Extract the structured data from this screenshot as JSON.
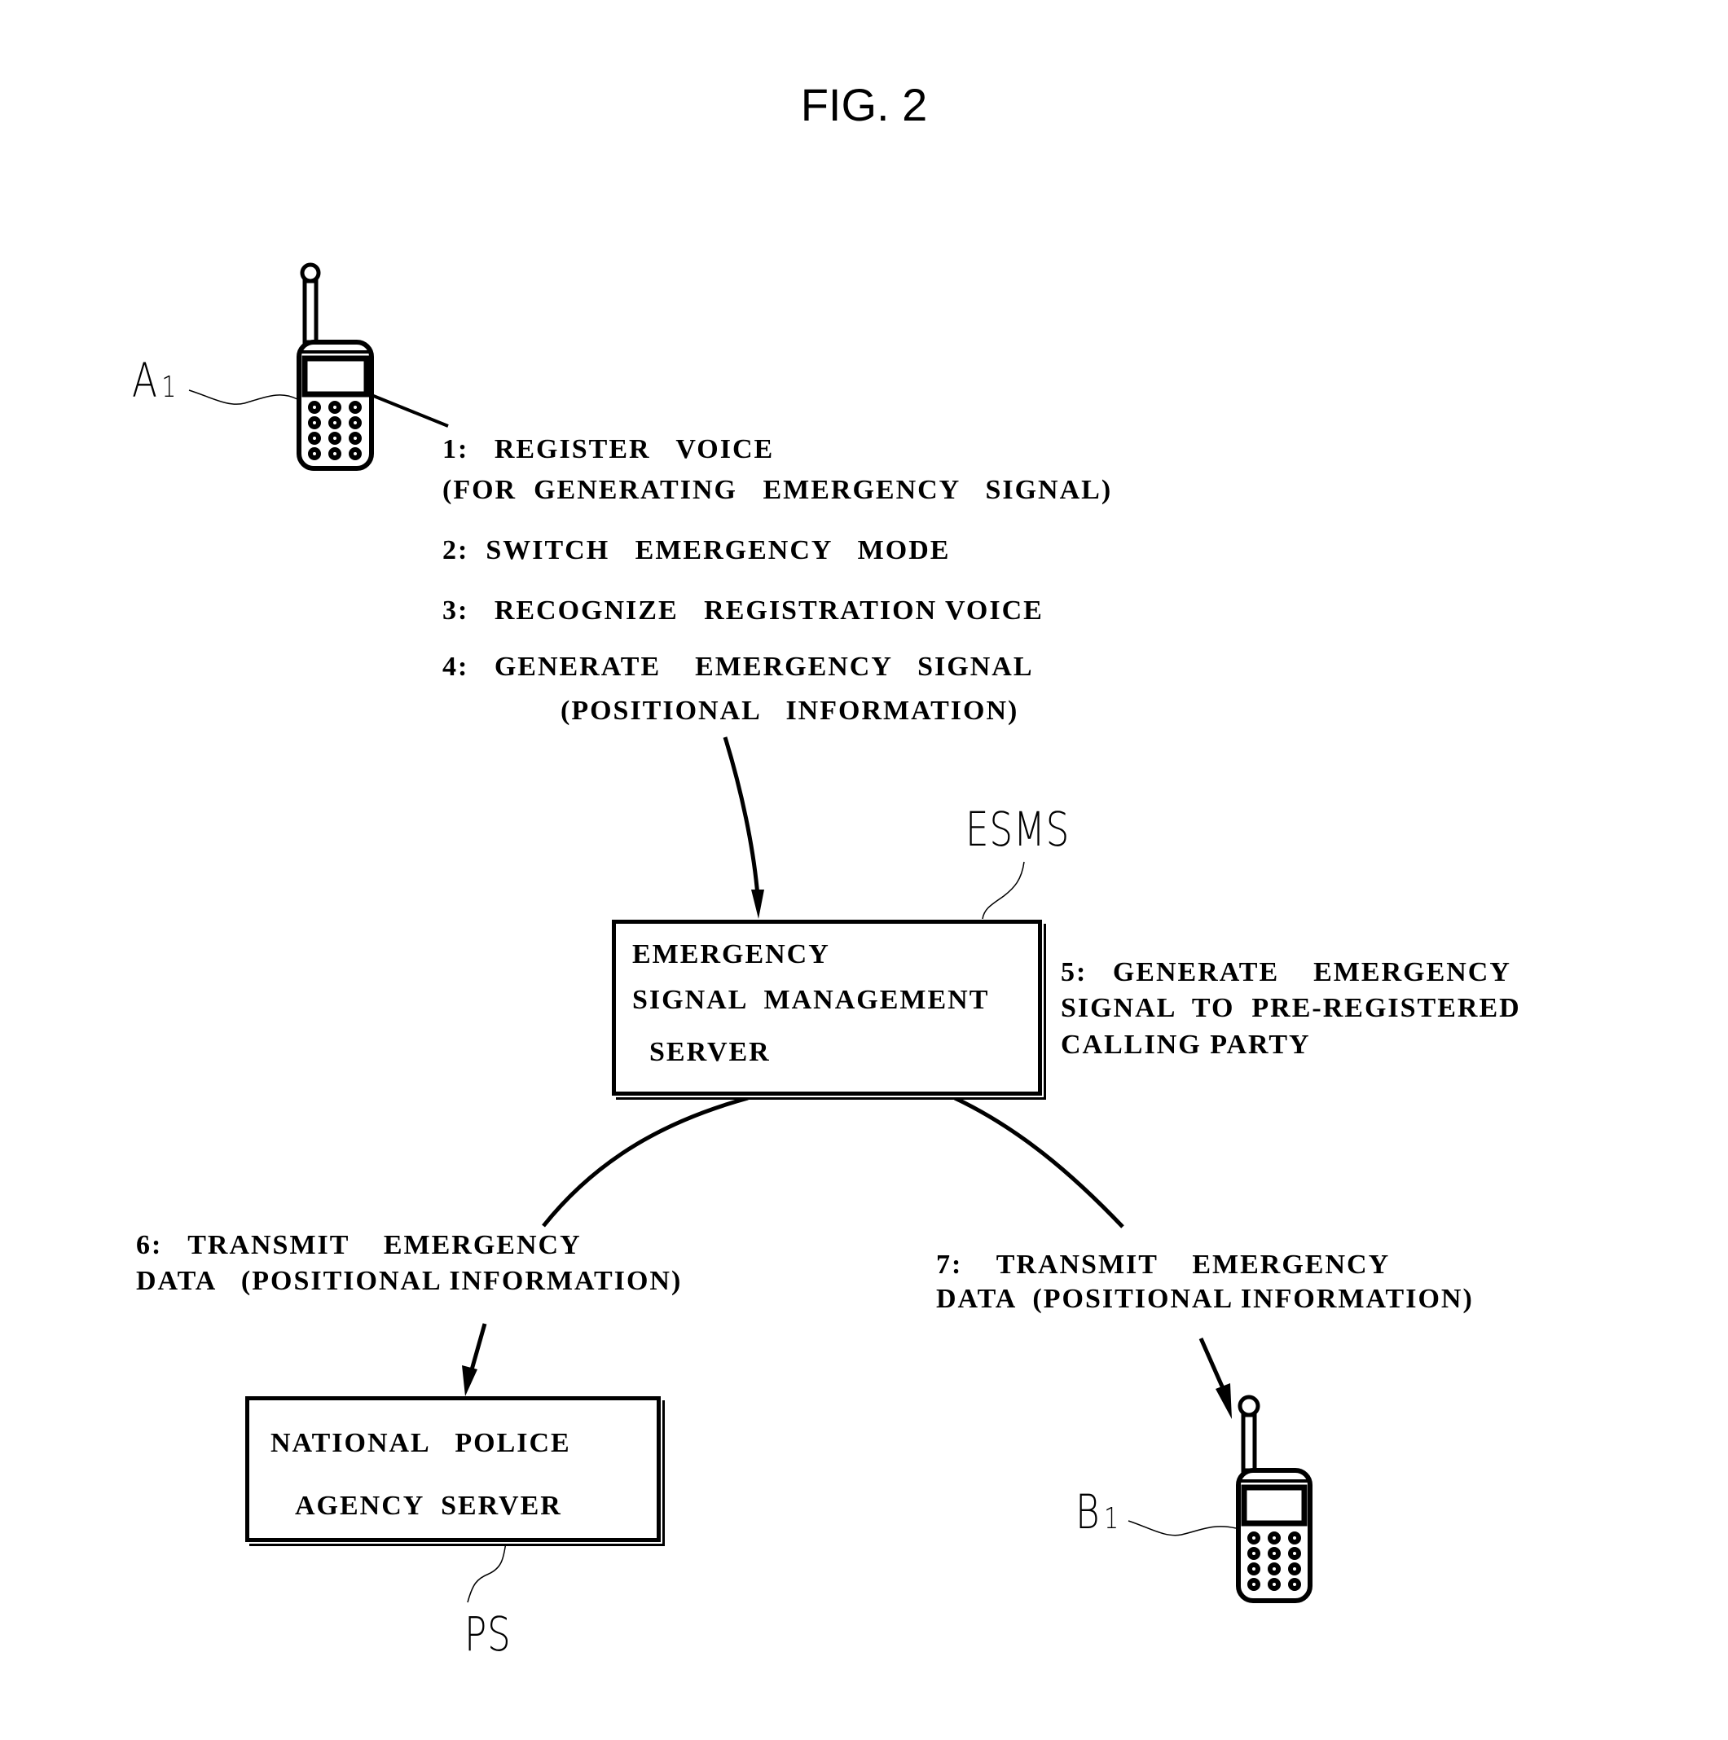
{
  "figure": {
    "title": "FIG. 2"
  },
  "references": {
    "a1": {
      "letter": "A",
      "index": "1"
    },
    "b1": {
      "letter": "B",
      "index": "1"
    },
    "esms": "ESMS",
    "ps": "PS"
  },
  "steps": {
    "step1": [
      "1:   REGISTER   VOICE",
      "(FOR  GENERATING   EMERGENCY   SIGNAL)"
    ],
    "step2": [
      "2:  SWITCH   EMERGENCY   MODE"
    ],
    "step3": [
      "3:   RECOGNIZE   REGISTRATION VOICE"
    ],
    "step4": [
      "4:   GENERATE    EMERGENCY   SIGNAL",
      "(POSITIONAL   INFORMATION)"
    ],
    "step5": [
      "5:   GENERATE    EMERGENCY",
      "SIGNAL  TO  PRE-REGISTERED",
      "CALLING PARTY"
    ],
    "step6": [
      "6:   TRANSMIT    EMERGENCY",
      "DATA   (POSITIONAL INFORMATION)"
    ],
    "step7": [
      "7:    TRANSMIT    EMERGENCY",
      "DATA  (POSITIONAL INFORMATION)"
    ]
  },
  "boxes": {
    "esms_server": [
      "EMERGENCY",
      "SIGNAL  MANAGEMENT",
      "  SERVER"
    ],
    "police_server": [
      "NATIONAL   POLICE",
      "AGENCY  SERVER"
    ]
  },
  "colors": {
    "ink": "#000000",
    "paper": "#ffffff"
  }
}
